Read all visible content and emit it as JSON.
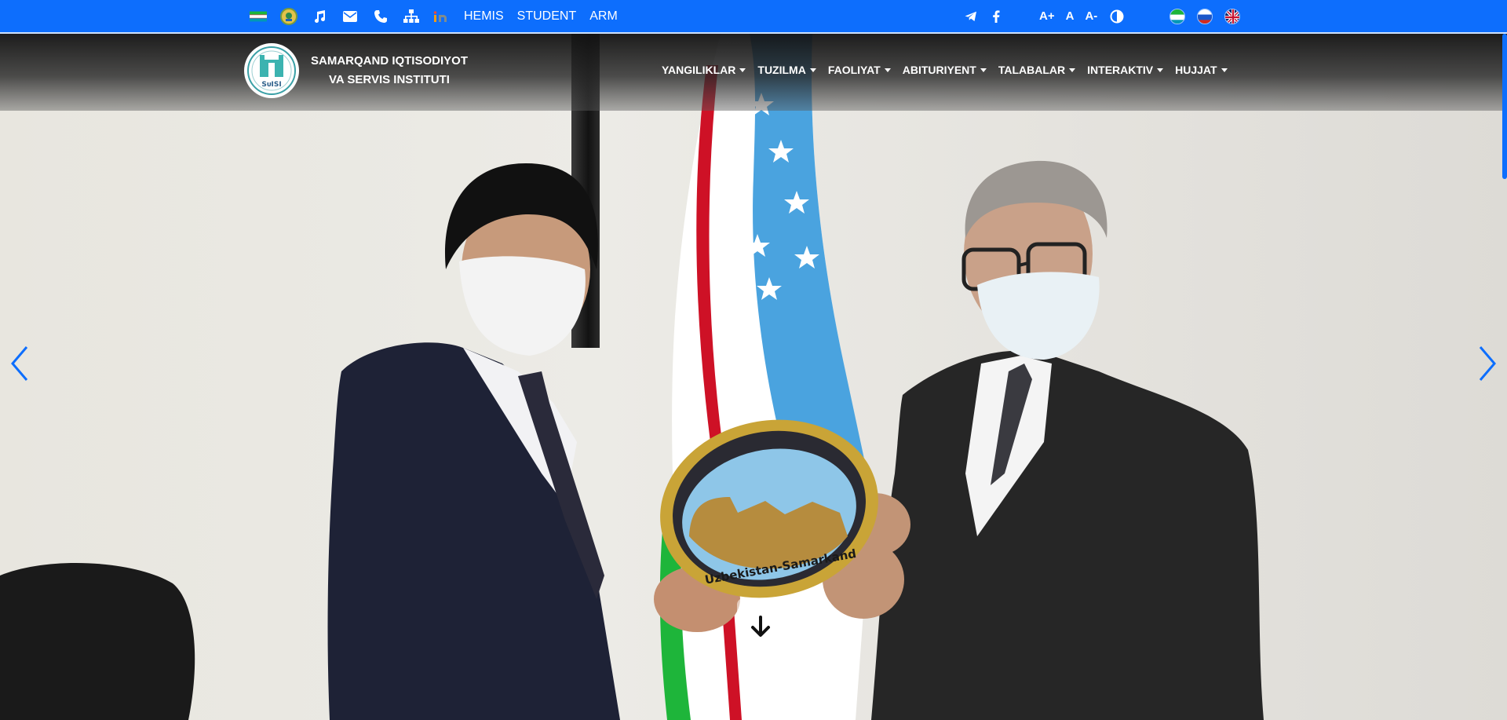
{
  "topbar": {
    "links": {
      "hemis": "HEMIS",
      "student": "STUDENT",
      "arm": "ARM"
    },
    "font_controls": {
      "increase": "A+",
      "normal": "A",
      "decrease": "A-"
    },
    "accent_color": "#0d6efd"
  },
  "brand": {
    "logo_text": "SᴜISI",
    "name": "SAMARQAND IQTISODIYOT VA SERVIS INSTITUTI"
  },
  "menu": {
    "items": [
      {
        "label": "YANGILIKLAR"
      },
      {
        "label": "TUZILMA"
      },
      {
        "label": "FAOLIYAT"
      },
      {
        "label": "ABITURIYENT"
      },
      {
        "label": "TALABALAR"
      },
      {
        "label": "INTERAKTIV"
      },
      {
        "label": "HUJJAT"
      }
    ]
  },
  "hero": {
    "plate_text": "Uzbekistan-Samarkand"
  }
}
